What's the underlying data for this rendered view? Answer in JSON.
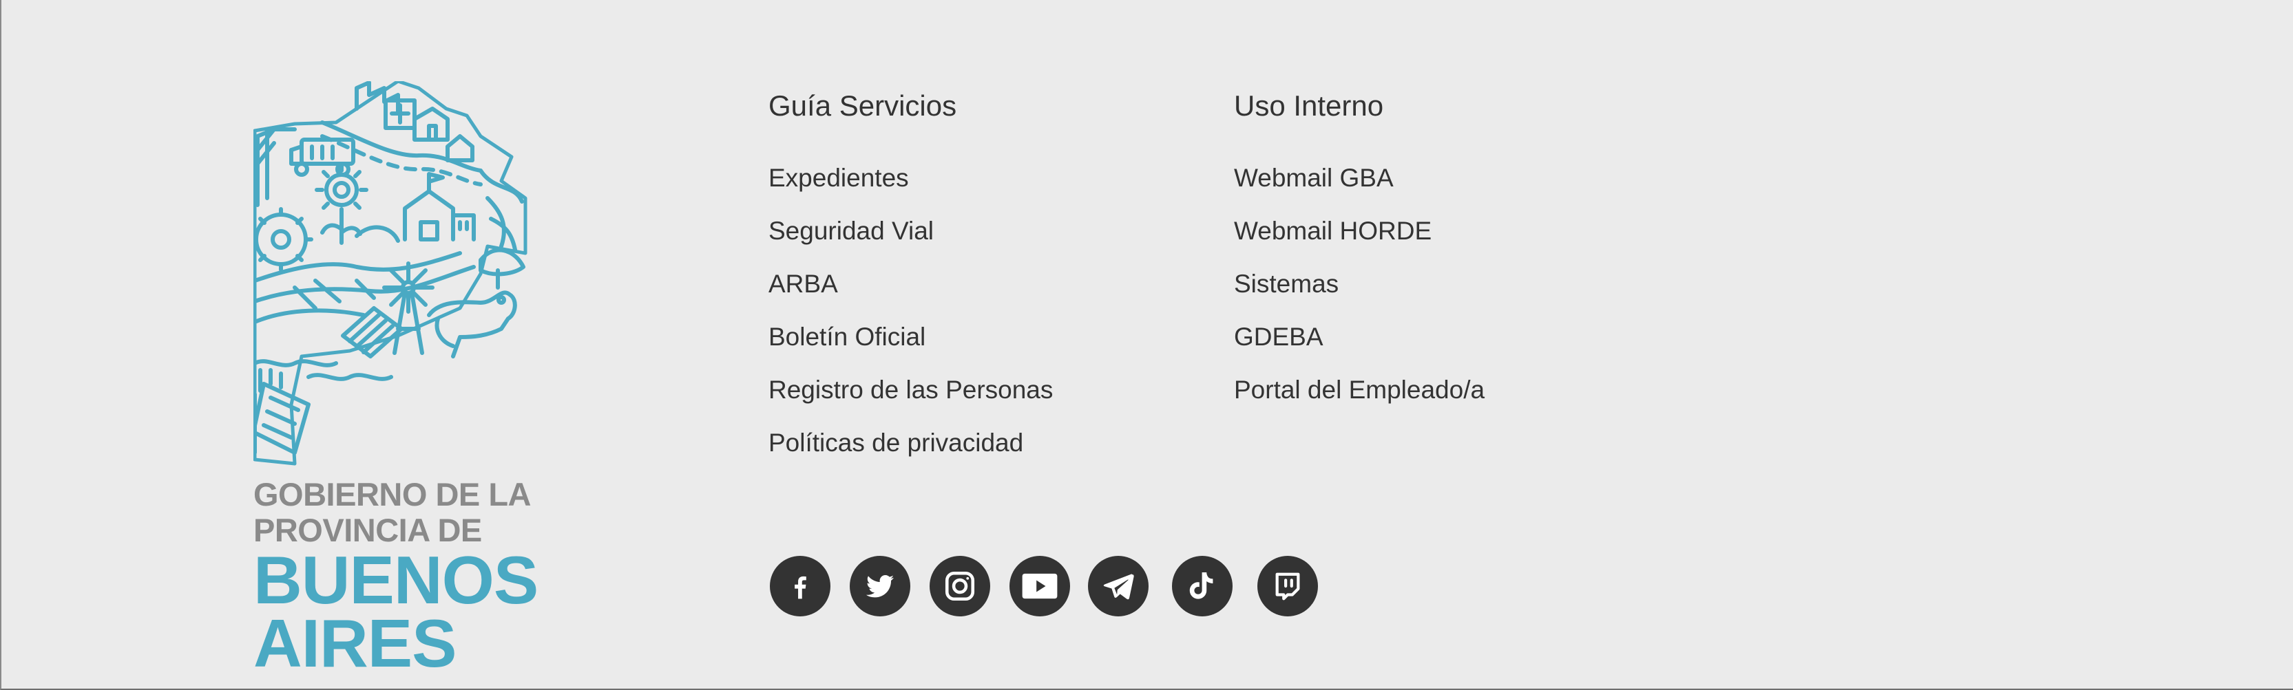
{
  "logo": {
    "line1": "GOBIERNO DE LA",
    "line2": "PROVINCIA DE",
    "line3": "BUENOS",
    "line4": "AIRES",
    "colors": {
      "brand_blue": "#4aa9c3",
      "gray": "#8a8a8a"
    }
  },
  "guia_servicios": {
    "title": "Guía Servicios",
    "links": [
      "Expedientes",
      "Seguridad Vial",
      "ARBA",
      "Boletín Oficial",
      "Registro de las Personas",
      "Políticas de privacidad"
    ]
  },
  "uso_interno": {
    "title": "Uso Interno",
    "links": [
      "Webmail GBA",
      "Webmail HORDE",
      "Sistemas",
      "GDEBA",
      "Portal del Empleado/a"
    ]
  },
  "social": [
    {
      "icon": "facebook-icon"
    },
    {
      "icon": "twitter-icon"
    },
    {
      "icon": "instagram-icon"
    },
    {
      "icon": "youtube-icon"
    },
    {
      "icon": "telegram-icon"
    },
    {
      "icon": "tiktok-icon"
    },
    {
      "icon": "twitch-icon"
    }
  ],
  "colors": {
    "background": "#ebebeb",
    "text": "#333333",
    "icon_bg": "#333333"
  }
}
